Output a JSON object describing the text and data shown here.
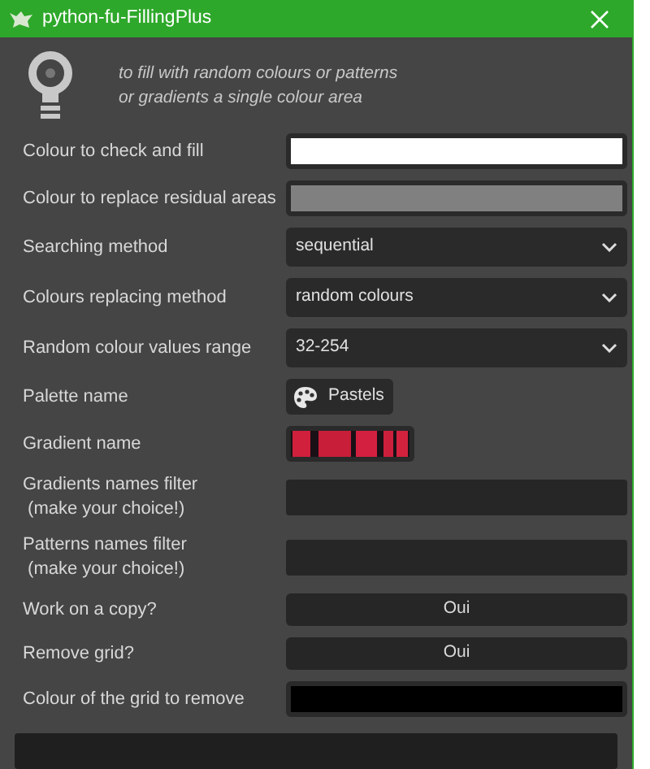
{
  "window": {
    "title": "python-fu-FillingPlus"
  },
  "description": [
    "to fill with random colours or patterns",
    "or gradients a single colour area"
  ],
  "rows": [
    {
      "kind": "color",
      "label": "Colour to check and fill",
      "color": "#ffffff"
    },
    {
      "kind": "color",
      "label": "Colour to replace residual areas",
      "color": "#808080"
    },
    {
      "kind": "select",
      "label": "Searching method",
      "value": "sequential"
    },
    {
      "kind": "select",
      "label": "Colours replacing method",
      "value": "random colours"
    },
    {
      "kind": "select",
      "label": "Random colour values range",
      "value": "32-254"
    },
    {
      "kind": "palette",
      "label": "Palette name",
      "value": "Pastels"
    },
    {
      "kind": "gradient",
      "label": "Gradient name"
    },
    {
      "kind": "text",
      "label": "Gradients names filter\n (make your choice!)"
    },
    {
      "kind": "text",
      "label": "Patterns names filter\n (make your choice!)"
    },
    {
      "kind": "toggle",
      "label": "Work on a copy?",
      "value": "Oui"
    },
    {
      "kind": "toggle",
      "label": "Remove grid?",
      "value": "Oui"
    },
    {
      "kind": "color",
      "label": "Colour of the grid to remove",
      "color": "#000000"
    }
  ]
}
